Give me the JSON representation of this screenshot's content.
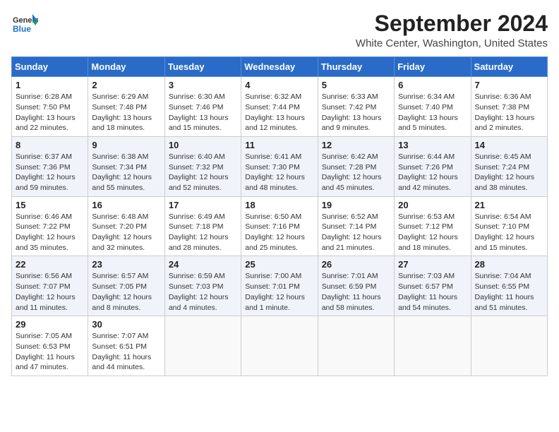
{
  "header": {
    "logo_general": "General",
    "logo_blue": "Blue",
    "month_title": "September 2024",
    "location": "White Center, Washington, United States"
  },
  "weekdays": [
    "Sunday",
    "Monday",
    "Tuesday",
    "Wednesday",
    "Thursday",
    "Friday",
    "Saturday"
  ],
  "weeks": [
    [
      {
        "day": "1",
        "info": "Sunrise: 6:28 AM\nSunset: 7:50 PM\nDaylight: 13 hours\nand 22 minutes."
      },
      {
        "day": "2",
        "info": "Sunrise: 6:29 AM\nSunset: 7:48 PM\nDaylight: 13 hours\nand 18 minutes."
      },
      {
        "day": "3",
        "info": "Sunrise: 6:30 AM\nSunset: 7:46 PM\nDaylight: 13 hours\nand 15 minutes."
      },
      {
        "day": "4",
        "info": "Sunrise: 6:32 AM\nSunset: 7:44 PM\nDaylight: 13 hours\nand 12 minutes."
      },
      {
        "day": "5",
        "info": "Sunrise: 6:33 AM\nSunset: 7:42 PM\nDaylight: 13 hours\nand 9 minutes."
      },
      {
        "day": "6",
        "info": "Sunrise: 6:34 AM\nSunset: 7:40 PM\nDaylight: 13 hours\nand 5 minutes."
      },
      {
        "day": "7",
        "info": "Sunrise: 6:36 AM\nSunset: 7:38 PM\nDaylight: 13 hours\nand 2 minutes."
      }
    ],
    [
      {
        "day": "8",
        "info": "Sunrise: 6:37 AM\nSunset: 7:36 PM\nDaylight: 12 hours\nand 59 minutes."
      },
      {
        "day": "9",
        "info": "Sunrise: 6:38 AM\nSunset: 7:34 PM\nDaylight: 12 hours\nand 55 minutes."
      },
      {
        "day": "10",
        "info": "Sunrise: 6:40 AM\nSunset: 7:32 PM\nDaylight: 12 hours\nand 52 minutes."
      },
      {
        "day": "11",
        "info": "Sunrise: 6:41 AM\nSunset: 7:30 PM\nDaylight: 12 hours\nand 48 minutes."
      },
      {
        "day": "12",
        "info": "Sunrise: 6:42 AM\nSunset: 7:28 PM\nDaylight: 12 hours\nand 45 minutes."
      },
      {
        "day": "13",
        "info": "Sunrise: 6:44 AM\nSunset: 7:26 PM\nDaylight: 12 hours\nand 42 minutes."
      },
      {
        "day": "14",
        "info": "Sunrise: 6:45 AM\nSunset: 7:24 PM\nDaylight: 12 hours\nand 38 minutes."
      }
    ],
    [
      {
        "day": "15",
        "info": "Sunrise: 6:46 AM\nSunset: 7:22 PM\nDaylight: 12 hours\nand 35 minutes."
      },
      {
        "day": "16",
        "info": "Sunrise: 6:48 AM\nSunset: 7:20 PM\nDaylight: 12 hours\nand 32 minutes."
      },
      {
        "day": "17",
        "info": "Sunrise: 6:49 AM\nSunset: 7:18 PM\nDaylight: 12 hours\nand 28 minutes."
      },
      {
        "day": "18",
        "info": "Sunrise: 6:50 AM\nSunset: 7:16 PM\nDaylight: 12 hours\nand 25 minutes."
      },
      {
        "day": "19",
        "info": "Sunrise: 6:52 AM\nSunset: 7:14 PM\nDaylight: 12 hours\nand 21 minutes."
      },
      {
        "day": "20",
        "info": "Sunrise: 6:53 AM\nSunset: 7:12 PM\nDaylight: 12 hours\nand 18 minutes."
      },
      {
        "day": "21",
        "info": "Sunrise: 6:54 AM\nSunset: 7:10 PM\nDaylight: 12 hours\nand 15 minutes."
      }
    ],
    [
      {
        "day": "22",
        "info": "Sunrise: 6:56 AM\nSunset: 7:07 PM\nDaylight: 12 hours\nand 11 minutes."
      },
      {
        "day": "23",
        "info": "Sunrise: 6:57 AM\nSunset: 7:05 PM\nDaylight: 12 hours\nand 8 minutes."
      },
      {
        "day": "24",
        "info": "Sunrise: 6:59 AM\nSunset: 7:03 PM\nDaylight: 12 hours\nand 4 minutes."
      },
      {
        "day": "25",
        "info": "Sunrise: 7:00 AM\nSunset: 7:01 PM\nDaylight: 12 hours\nand 1 minute."
      },
      {
        "day": "26",
        "info": "Sunrise: 7:01 AM\nSunset: 6:59 PM\nDaylight: 11 hours\nand 58 minutes."
      },
      {
        "day": "27",
        "info": "Sunrise: 7:03 AM\nSunset: 6:57 PM\nDaylight: 11 hours\nand 54 minutes."
      },
      {
        "day": "28",
        "info": "Sunrise: 7:04 AM\nSunset: 6:55 PM\nDaylight: 11 hours\nand 51 minutes."
      }
    ],
    [
      {
        "day": "29",
        "info": "Sunrise: 7:05 AM\nSunset: 6:53 PM\nDaylight: 11 hours\nand 47 minutes."
      },
      {
        "day": "30",
        "info": "Sunrise: 7:07 AM\nSunset: 6:51 PM\nDaylight: 11 hours\nand 44 minutes."
      },
      {
        "day": "",
        "info": ""
      },
      {
        "day": "",
        "info": ""
      },
      {
        "day": "",
        "info": ""
      },
      {
        "day": "",
        "info": ""
      },
      {
        "day": "",
        "info": ""
      }
    ]
  ]
}
